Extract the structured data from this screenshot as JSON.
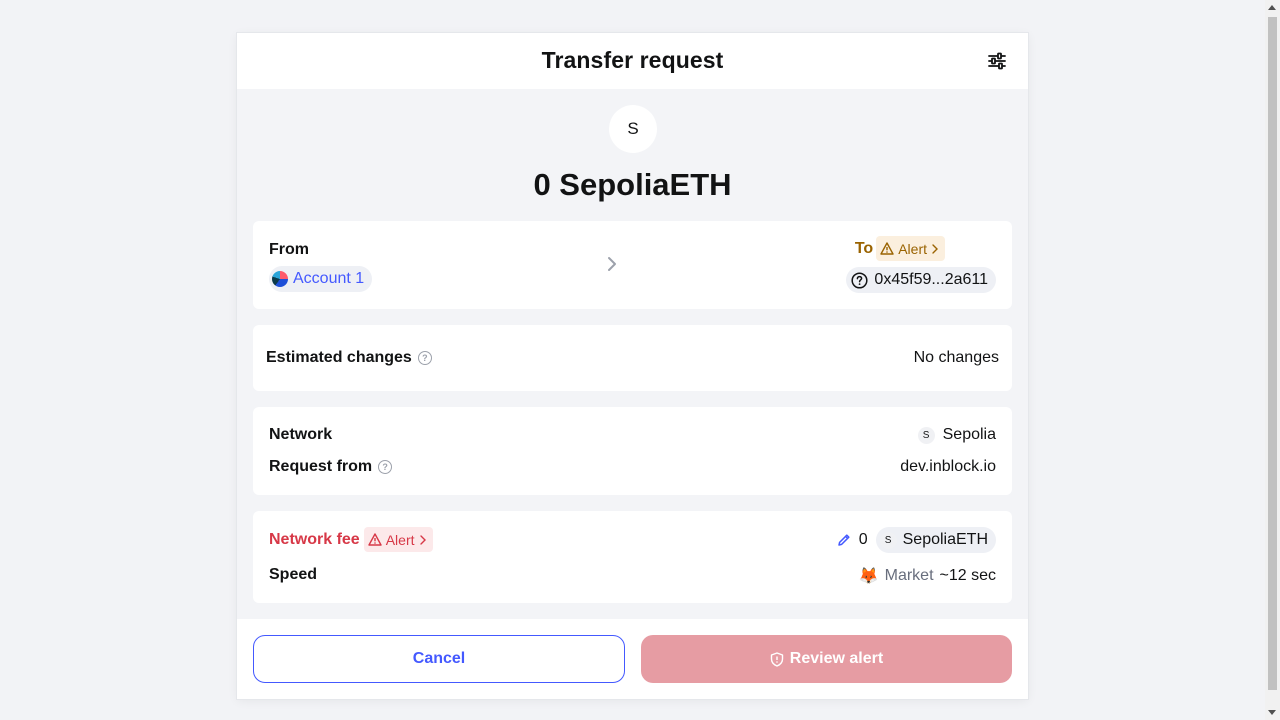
{
  "header": {
    "title": "Transfer request",
    "settings_icon": "sliders-icon"
  },
  "token": {
    "symbol_letter": "S",
    "amount_text": "0 SepoliaETH"
  },
  "transfer": {
    "from_label": "From",
    "account_name": "Account 1",
    "to_label": "To",
    "to_alert": "Alert",
    "to_address": "0x45f59...2a611"
  },
  "estimated": {
    "label": "Estimated changes",
    "value": "No changes"
  },
  "details": {
    "network_label": "Network",
    "network_letter": "S",
    "network_value": "Sepolia",
    "request_from_label": "Request from",
    "request_from_value": "dev.inblock.io"
  },
  "fee": {
    "label": "Network fee",
    "alert": "Alert",
    "amount": "0",
    "token_letter": "S",
    "token": "SepoliaETH",
    "speed_label": "Speed",
    "speed_market": "Market",
    "speed_time": "~12 sec"
  },
  "footer": {
    "cancel_label": "Cancel",
    "review_label": "Review alert"
  },
  "colors": {
    "accent": "#4459ff",
    "warning": "#9a6300",
    "danger": "#d73847",
    "review_disabled": "#e69ca3"
  }
}
